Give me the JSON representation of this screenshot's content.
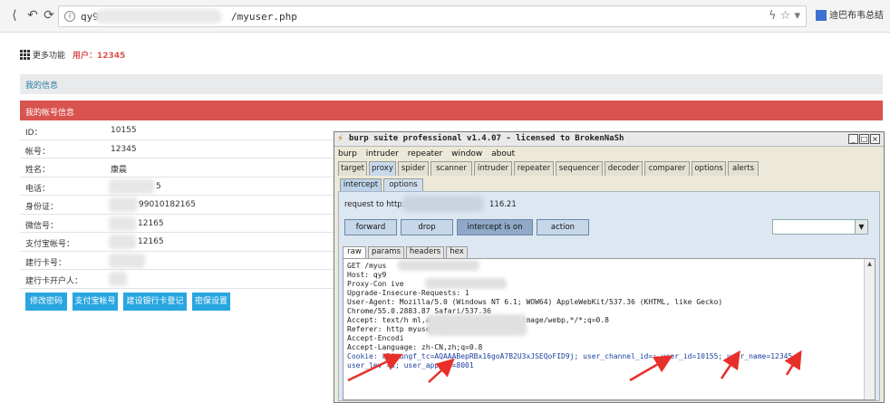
{
  "browser": {
    "url_start": "qy9",
    "url_end": "/myuser.php",
    "ext_text": "迪巴布韦总结",
    "icons": [
      "back-icon",
      "forward-icon",
      "refresh-icon",
      "info-icon",
      "lightning-icon",
      "star-icon",
      "dropdown-icon"
    ]
  },
  "page": {
    "more_label": "更多功能",
    "user_label": "用户：12345",
    "section_my_info": "我的信息",
    "section_account": "我的帐号信息",
    "rows": [
      {
        "label": "ID：",
        "value": "10155"
      },
      {
        "label": "帐号：",
        "value": "12345"
      },
      {
        "label": "姓名：",
        "value": "康晨"
      },
      {
        "label": "电话：",
        "value": "5"
      },
      {
        "label": "身份证：",
        "value": "99010182165"
      },
      {
        "label": "微信号：",
        "value": "12165"
      },
      {
        "label": "支付宝帐号：",
        "value": "12165"
      },
      {
        "label": "建行卡号：",
        "value": ""
      },
      {
        "label": "建行卡开户人：",
        "value": ""
      }
    ],
    "buttons": [
      "修改密码",
      "支付宝帐号",
      "建设银行卡登记",
      "密保设置"
    ]
  },
  "burp": {
    "title": "burp suite professional v1.4.07 - licensed to BrokenNaSh",
    "menu": [
      "burp",
      "intruder",
      "repeater",
      "window",
      "about"
    ],
    "tabs": [
      "target",
      "proxy",
      "spider",
      "scanner",
      "intruder",
      "repeater",
      "sequencer",
      "decoder",
      "comparer",
      "options",
      "alerts"
    ],
    "subtabs": [
      "intercept",
      "options"
    ],
    "request_label": "request to http://",
    "request_ip": "116.21",
    "action_buttons": [
      "forward",
      "drop",
      "intercept is on",
      "action"
    ],
    "view_tabs": [
      "raw",
      "params",
      "headers",
      "hex"
    ],
    "lines": [
      "GET /myus",
      "Host: qy9",
      "Proxy-Con                          ive",
      "Upgrade-Insecure-Requests: 1",
      "User-Agent: Mozilla/5.0 (Windows NT 6.1; WOW64) AppleWebKit/537.36 (KHTML, like Gecko)",
      "Chrome/55.0.2883.87 Safari/537.36",
      "Accept: text/h                         ml,application/xml;q=0.9,image/webp,*/*;q=0.8",
      "Referer: http                          myuser.php",
      "Accept-Encodi",
      "Accept-Language: zh-CN,zh;q=0.8"
    ],
    "cookie_line": "Cookie: aliyungf_tc=AQAAABepRBx16goA7B2U3xJSEQoFID9j; user_channel_id=; user_id=10155; user_name=12345;",
    "cookie_line2": "user_lev  =3; user_app_id=8001"
  },
  "colors": {
    "red_band": "#d9534f",
    "blue_button": "#29a6e0",
    "arrow": "#e8302a"
  }
}
